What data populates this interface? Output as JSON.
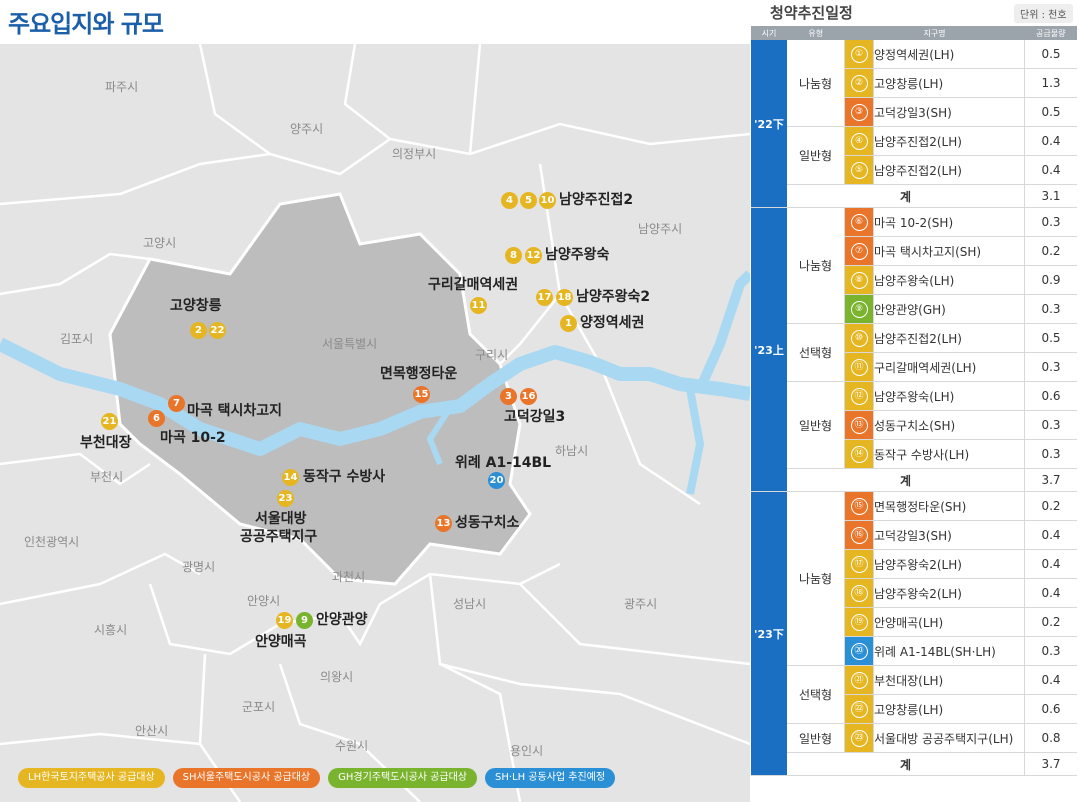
{
  "title": "주요입지와 규모",
  "colors": {
    "lh": "#e6b622",
    "sh": "#e9752a",
    "gh": "#7ab32d",
    "jt": "#2b8fd6",
    "period": "#1b6fc2"
  },
  "map": {
    "regions": [
      "파주시",
      "양주시",
      "의정부시",
      "고양시",
      "남양주시",
      "김포시",
      "서울특별시",
      "구리시",
      "부천시",
      "하남시",
      "인천광역시",
      "광명시",
      "과천시",
      "안양시",
      "성남시",
      "광주시",
      "시흥시",
      "의왕시",
      "군포시",
      "안산시",
      "수원시",
      "용인시"
    ],
    "projects": [
      {
        "label": "남양주진접2",
        "badges": [
          {
            "n": "4",
            "c": "lh"
          },
          {
            "n": "5",
            "c": "lh"
          },
          {
            "n": "10",
            "c": "lh"
          }
        ]
      },
      {
        "label": "남양주왕숙",
        "badges": [
          {
            "n": "8",
            "c": "lh"
          },
          {
            "n": "12",
            "c": "lh"
          }
        ]
      },
      {
        "label": "구리갈매역세권",
        "badges": [
          {
            "n": "11",
            "c": "lh"
          }
        ]
      },
      {
        "label": "남양주왕숙2",
        "badges": [
          {
            "n": "17",
            "c": "lh"
          },
          {
            "n": "18",
            "c": "lh"
          }
        ]
      },
      {
        "label": "양정역세권",
        "badges": [
          {
            "n": "1",
            "c": "lh"
          }
        ]
      },
      {
        "label": "고양창릉",
        "badges": [
          {
            "n": "2",
            "c": "lh"
          },
          {
            "n": "22",
            "c": "lh"
          }
        ]
      },
      {
        "label": "면목행정타운",
        "badges": [
          {
            "n": "15",
            "c": "sh"
          }
        ]
      },
      {
        "label": "고덕강일3",
        "badges": [
          {
            "n": "3",
            "c": "sh"
          },
          {
            "n": "16",
            "c": "sh"
          }
        ]
      },
      {
        "label": "마곡 택시차고지",
        "badges": [
          {
            "n": "7",
            "c": "sh"
          }
        ]
      },
      {
        "label": "마곡 10-2",
        "badges": [
          {
            "n": "6",
            "c": "sh"
          }
        ]
      },
      {
        "label": "부천대장",
        "badges": [
          {
            "n": "21",
            "c": "lh"
          }
        ]
      },
      {
        "label": "위례 A1-14BL",
        "badges": [
          {
            "n": "20",
            "c": "jt"
          }
        ]
      },
      {
        "label": "동작구 수방사",
        "badges": [
          {
            "n": "14",
            "c": "lh"
          }
        ]
      },
      {
        "label": "서울대방",
        "badges": [
          {
            "n": "23",
            "c": "lh"
          }
        ]
      },
      {
        "label": "공공주택지구",
        "badges": []
      },
      {
        "label": "성동구치소",
        "badges": [
          {
            "n": "13",
            "c": "sh"
          }
        ]
      },
      {
        "label": "안양관양",
        "badges": [
          {
            "n": "9",
            "c": "gh"
          }
        ]
      },
      {
        "label": "안양매곡",
        "badges": [
          {
            "n": "19",
            "c": "lh"
          }
        ]
      }
    ]
  },
  "legend": [
    {
      "label": "LH한국토지주택공사 공급대상",
      "c": "lh"
    },
    {
      "label": "SH서울주택도시공사 공급대상",
      "c": "sh"
    },
    {
      "label": "GH경기주택도시공사 공급대상",
      "c": "gh"
    },
    {
      "label": "SH·LH 공동사업 추진예정",
      "c": "jt"
    }
  ],
  "schedule": {
    "title": "청약추진일정",
    "unit": "단위 : 천호",
    "headers": [
      "시기",
      "유형",
      "지구명",
      "공급물량"
    ],
    "total_label": "계",
    "periods": [
      {
        "label": "'22下",
        "total": "3.1",
        "groups": [
          {
            "type": "나눔형",
            "rows": [
              [
                "①",
                "양정역세권(LH)",
                "0.5",
                "lh"
              ],
              [
                "②",
                "고양창릉(LH)",
                "1.3",
                "lh"
              ],
              [
                "③",
                "고덕강일3(SH)",
                "0.5",
                "sh"
              ]
            ]
          },
          {
            "type": "일반형",
            "rows": [
              [
                "④",
                "남양주진접2(LH)",
                "0.4",
                "lh"
              ],
              [
                "⑤",
                "남양주진접2(LH)",
                "0.4",
                "lh"
              ]
            ]
          }
        ]
      },
      {
        "label": "'23上",
        "total": "3.7",
        "groups": [
          {
            "type": "나눔형",
            "rows": [
              [
                "⑥",
                "마곡 10-2(SH)",
                "0.3",
                "sh"
              ],
              [
                "⑦",
                "마곡 택시차고지(SH)",
                "0.2",
                "sh"
              ],
              [
                "⑧",
                "남양주왕숙(LH)",
                "0.9",
                "lh"
              ],
              [
                "⑨",
                "안양관양(GH)",
                "0.3",
                "gh"
              ]
            ]
          },
          {
            "type": "선택형",
            "rows": [
              [
                "⑩",
                "남양주진접2(LH)",
                "0.5",
                "lh"
              ],
              [
                "⑪",
                "구리갈매역세권(LH)",
                "0.3",
                "lh"
              ]
            ]
          },
          {
            "type": "일반형",
            "rows": [
              [
                "⑫",
                "남양주왕숙(LH)",
                "0.6",
                "lh"
              ],
              [
                "⑬",
                "성동구치소(SH)",
                "0.3",
                "sh"
              ],
              [
                "⑭",
                "동작구 수방사(LH)",
                "0.3",
                "lh"
              ]
            ]
          }
        ]
      },
      {
        "label": "'23下",
        "total": "3.7",
        "groups": [
          {
            "type": "나눔형",
            "rows": [
              [
                "⑮",
                "면목행정타운(SH)",
                "0.2",
                "sh"
              ],
              [
                "⑯",
                "고덕강일3(SH)",
                "0.4",
                "sh"
              ],
              [
                "⑰",
                "남양주왕숙2(LH)",
                "0.4",
                "lh"
              ],
              [
                "⑱",
                "남양주왕숙2(LH)",
                "0.4",
                "lh"
              ],
              [
                "⑲",
                "안양매곡(LH)",
                "0.2",
                "lh"
              ],
              [
                "⑳",
                "위례 A1-14BL(SH·LH)",
                "0.3",
                "jt"
              ]
            ]
          },
          {
            "type": "선택형",
            "rows": [
              [
                "㉑",
                "부천대장(LH)",
                "0.4",
                "lh"
              ],
              [
                "㉒",
                "고양창릉(LH)",
                "0.6",
                "lh"
              ]
            ]
          },
          {
            "type": "일반형",
            "rows": [
              [
                "㉓",
                "서울대방 공공주택지구(LH)",
                "0.8",
                "lh"
              ]
            ]
          }
        ]
      }
    ]
  }
}
